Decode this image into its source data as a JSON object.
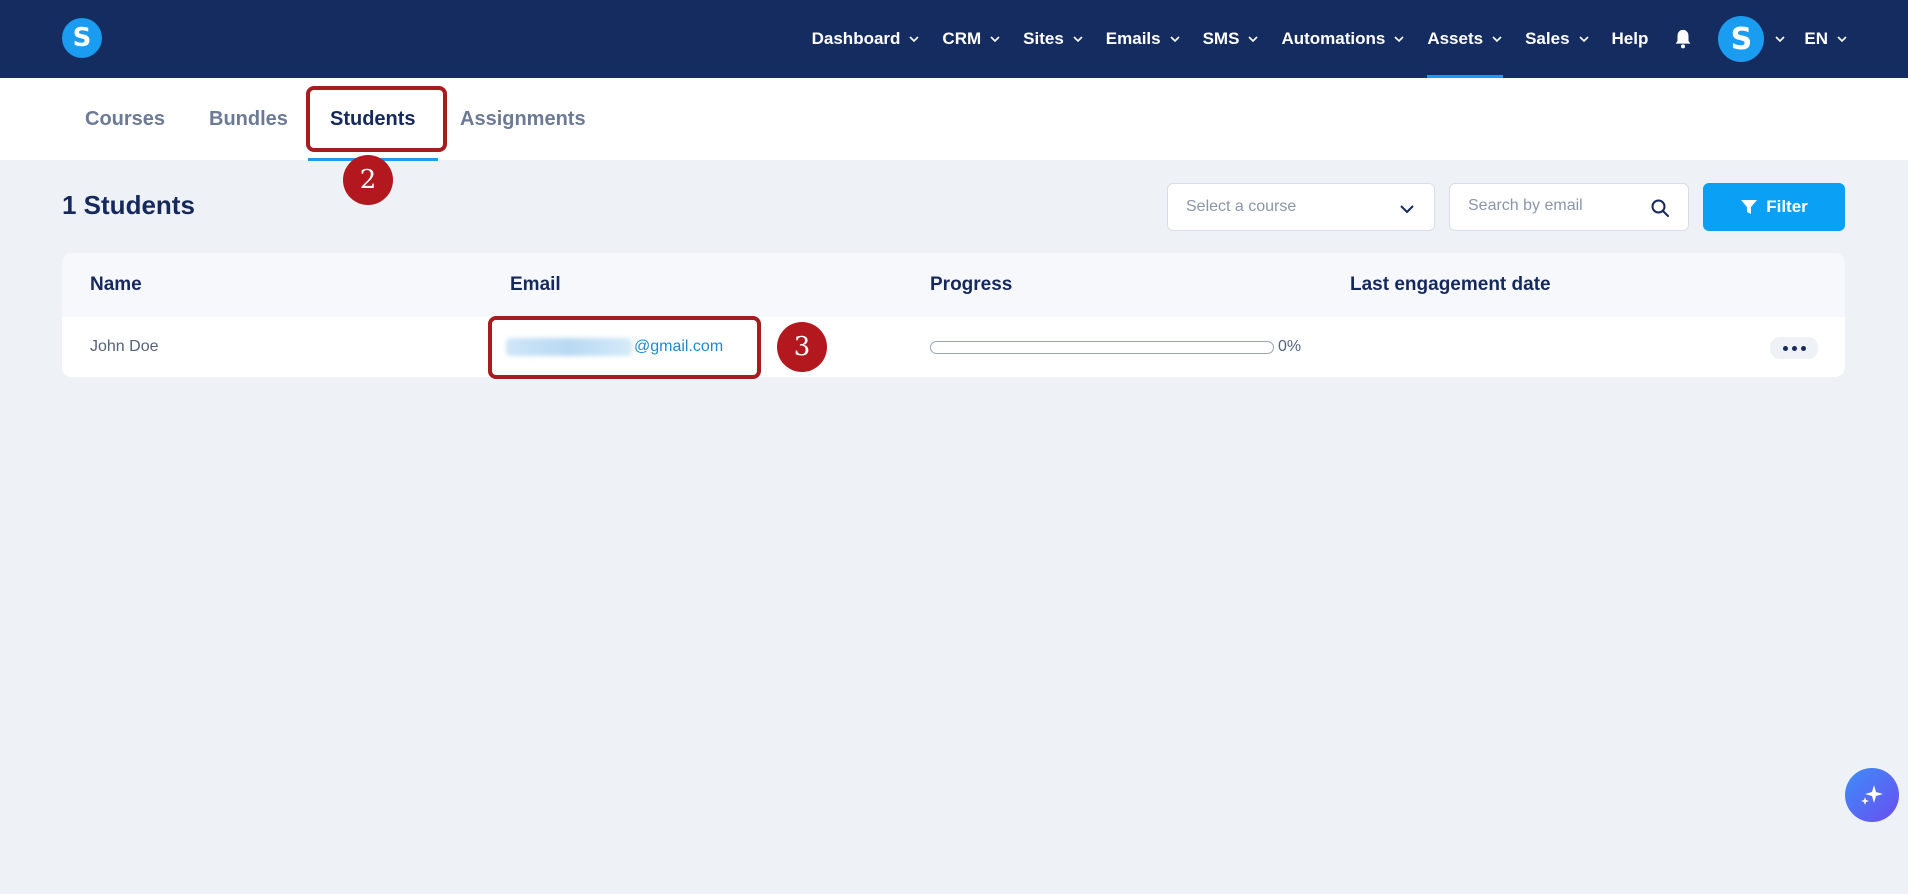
{
  "brand": {
    "logo_letter": "S",
    "accent": "#1a9cf0",
    "nav_bg": "#152c61"
  },
  "nav": {
    "items": [
      {
        "label": "Dashboard",
        "dropdown": true
      },
      {
        "label": "CRM",
        "dropdown": true
      },
      {
        "label": "Sites",
        "dropdown": true
      },
      {
        "label": "Emails",
        "dropdown": true
      },
      {
        "label": "SMS",
        "dropdown": true
      },
      {
        "label": "Automations",
        "dropdown": true
      },
      {
        "label": "Assets",
        "dropdown": true,
        "active": true
      },
      {
        "label": "Sales",
        "dropdown": true
      },
      {
        "label": "Help",
        "dropdown": false
      }
    ],
    "notification_icon": "bell-icon",
    "avatar_letter": "S",
    "language": "EN"
  },
  "tabs": [
    {
      "label": "Courses"
    },
    {
      "label": "Bundles"
    },
    {
      "label": "Students",
      "active": true
    },
    {
      "label": "Assignments"
    }
  ],
  "annotations": [
    {
      "number": "2",
      "target": "Students tab"
    },
    {
      "number": "3",
      "target": "email cell"
    }
  ],
  "header": {
    "title": "1 Students",
    "course_select_placeholder": "Select a course",
    "search_placeholder": "Search by email",
    "filter_label": "Filter"
  },
  "table": {
    "columns": [
      "Name",
      "Email",
      "Progress",
      "Last engagement date"
    ],
    "rows": [
      {
        "name": "John Doe",
        "email_visible_domain": "@gmail.com",
        "email_local_blurred": true,
        "progress_percent": 0,
        "progress_label": "0%",
        "last_engagement_date": ""
      }
    ]
  },
  "fab": {
    "icon": "sparkle-icon"
  }
}
